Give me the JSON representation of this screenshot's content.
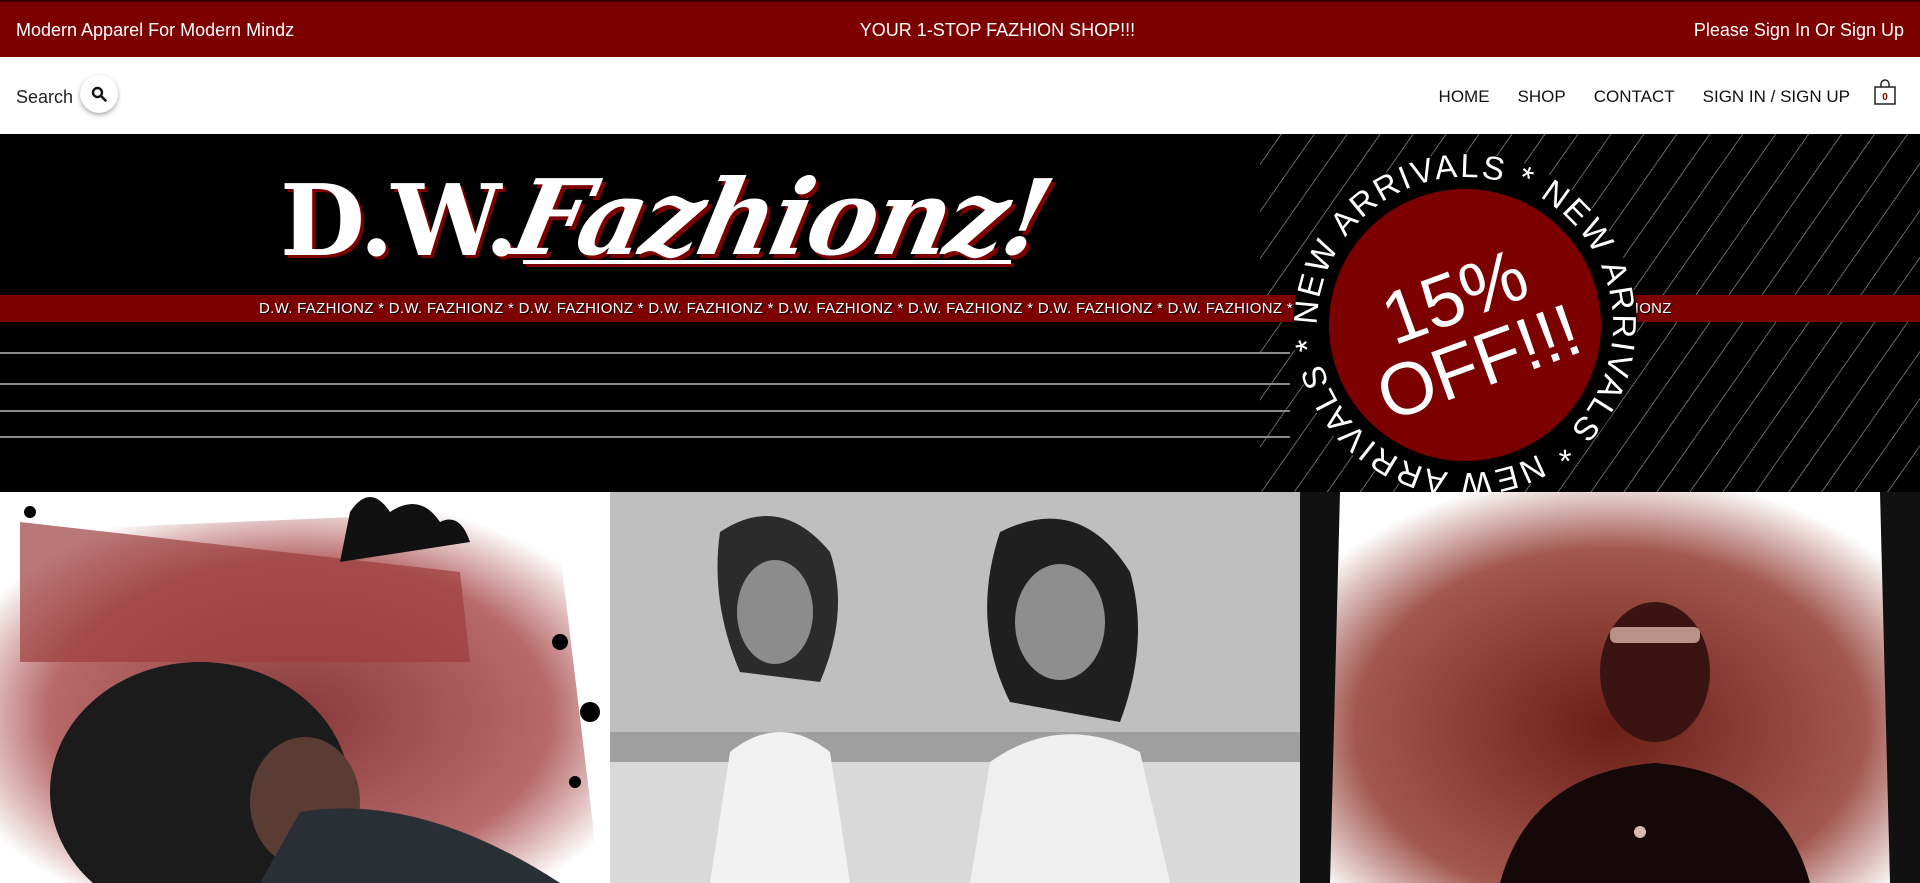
{
  "topbar": {
    "tagline": "Modern Apparel For Modern Mindz",
    "promo": "YOUR 1-STOP FAZHION SHOP!!!",
    "auth_prompt": "Please Sign In Or Sign Up"
  },
  "navbar": {
    "search_label": "Search",
    "links": [
      "HOME",
      "SHOP",
      "CONTACT",
      "SIGN IN / SIGN UP"
    ],
    "cart_count": "0",
    "search_icon": "search-icon",
    "cart_icon": "shopping-bag-icon"
  },
  "hero": {
    "logo_prefix": "D.W.",
    "logo_script": "Fazhionz!",
    "marquee": "D.W. FAZHIONZ * D.W. FAZHIONZ * D.W. FAZHIONZ * D.W. FAZHIONZ * D.W. FAZHIONZ * D.W. FAZHIONZ * D.W. FAZHIONZ * D.W. FAZHIONZ * D.W. FAZHIONZ * D.W. FAZHIONZ * D.W. FAZHIONZ",
    "badge": {
      "ring_text": "NEW ARRIVALS * NEW ARRIVALS * NEW ARRIVALS * ",
      "line1": "15%",
      "line2": "OFF!!!"
    }
  },
  "colors": {
    "brand_red": "#7d0000",
    "black": "#000000",
    "white": "#ffffff"
  }
}
